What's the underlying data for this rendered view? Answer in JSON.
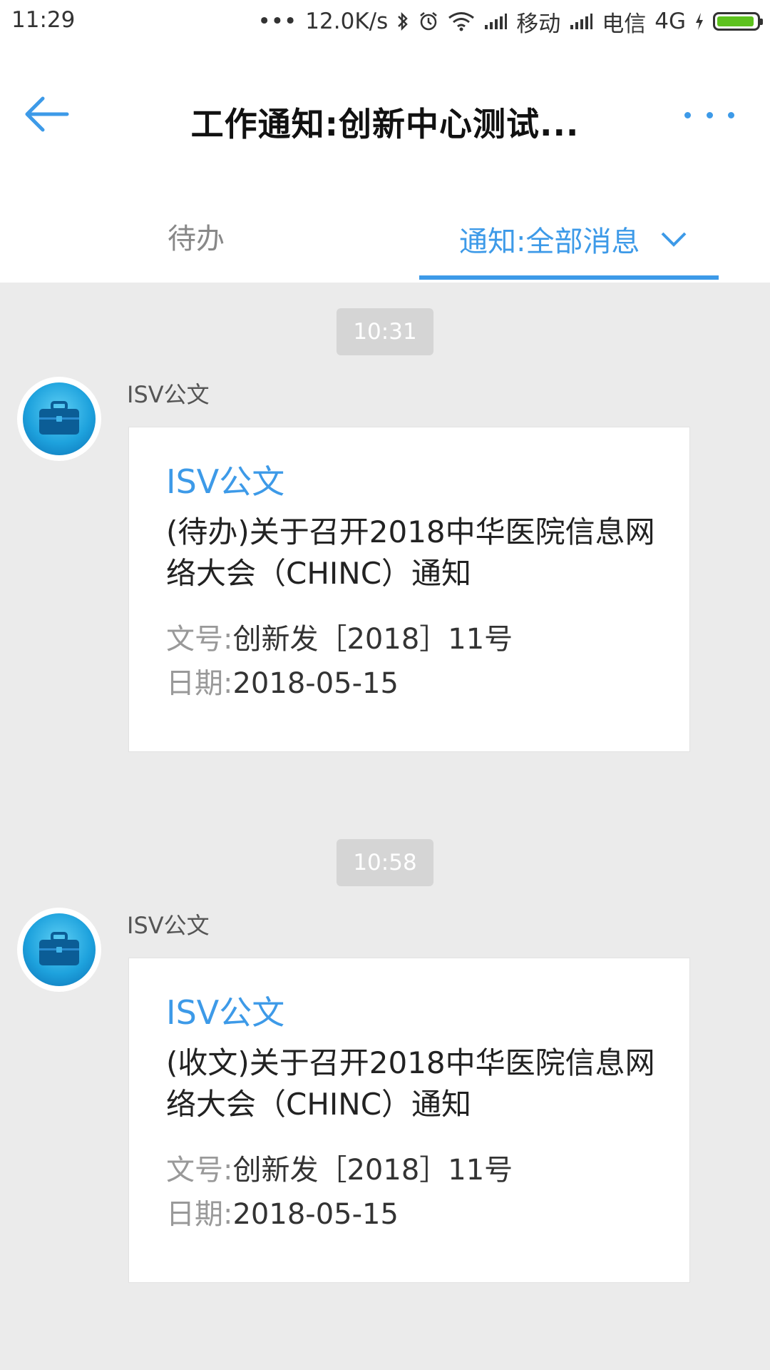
{
  "status_bar": {
    "time": "11:29",
    "dots": "•••",
    "speed": "12.0K/s",
    "carrier1": "移动",
    "carrier2": "电信",
    "network": "4G",
    "battery_color": "#5dc21e"
  },
  "header": {
    "title": "工作通知:创新中心测试..."
  },
  "tabs": {
    "todo_label": "待办",
    "notice_label": "通知:全部消息",
    "active": "notice"
  },
  "messages": [
    {
      "time": "10:31",
      "sender": "ISV公文",
      "card_title": "ISV公文",
      "body": "(待办)关于召开2018中华医院信息网络大会（CHINC）通知",
      "doc_no_key": "文号:",
      "doc_no_value": "创新发［2018］11号",
      "date_key": "日期:",
      "date_value": "2018-05-15"
    },
    {
      "time": "10:58",
      "sender": "ISV公文",
      "card_title": "ISV公文",
      "body": "(收文)关于召开2018中华医院信息网络大会（CHINC）通知",
      "doc_no_key": "文号:",
      "doc_no_value": "创新发［2018］11号",
      "date_key": "日期:",
      "date_value": "2018-05-15"
    }
  ],
  "colors": {
    "accent": "#3d9ae8",
    "background": "#ebebeb"
  }
}
